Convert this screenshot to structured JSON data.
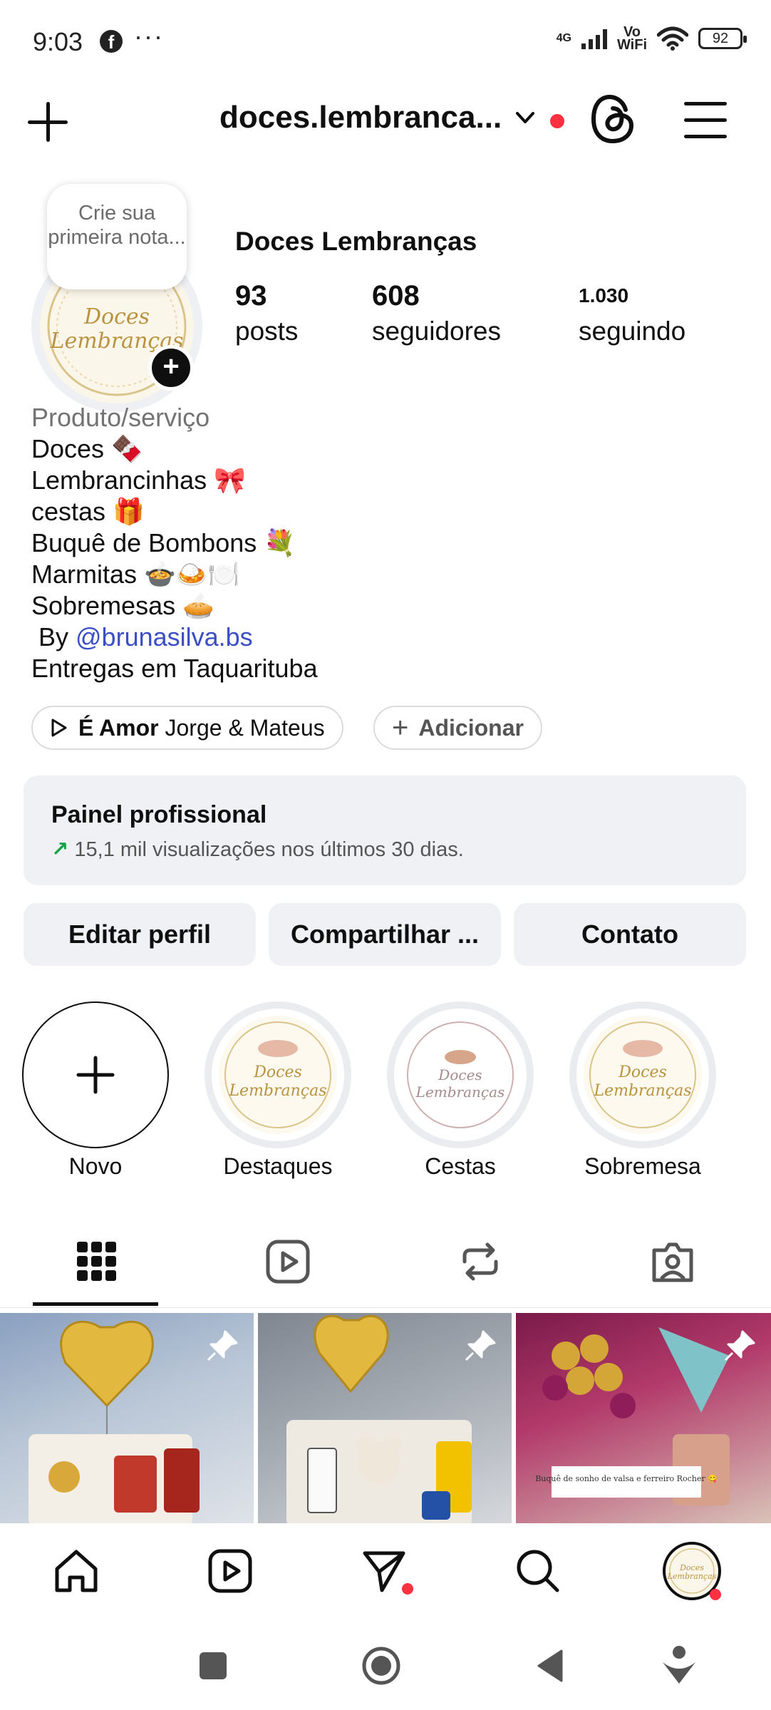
{
  "status_bar": {
    "time": "9:03",
    "facebook_icon": "f",
    "more": "···",
    "network": "4G",
    "wifi_label_top": "Vo",
    "wifi_label_bottom": "WiFi",
    "battery": "92"
  },
  "header": {
    "username": "doces.lembranca...",
    "icons": [
      "plus-icon",
      "chevron-down-icon",
      "threads-icon",
      "menu-icon"
    ],
    "notification_dot_color": "#ff3040"
  },
  "profile": {
    "note_bubble": "Crie sua primeira nota...",
    "avatar_text_top": "Doces",
    "avatar_text_bottom": "Lembranças",
    "display_name": "Doces Lembranças",
    "stats": [
      {
        "value": "93",
        "label": "posts"
      },
      {
        "value": "608",
        "label": "seguidores"
      },
      {
        "value": "1.030",
        "label": "seguindo"
      }
    ]
  },
  "bio": {
    "category": "Produto/serviço",
    "lines": [
      "Doces 🍫",
      "Lembrancinhas 🎀",
      "cestas 🎁",
      "Buquê de Bombons 💐",
      "Marmitas 🍲🍛🍽️",
      "Sobremesas 🥧"
    ],
    "by_prefix": " By ",
    "mention": "@brunasilva.bs",
    "last_line": "Entregas em Taquarituba"
  },
  "music_chip": {
    "song": "É Amor",
    "artist": "Jorge & Mateus"
  },
  "add_chip": {
    "label": "Adicionar"
  },
  "dashboard": {
    "title": "Painel profissional",
    "subtitle": "15,1 mil visualizações nos últimos 30 dias.",
    "trend_color": "#17a34a"
  },
  "actions": {
    "edit": "Editar perfil",
    "share": "Compartilhar ...",
    "contact": "Contato"
  },
  "highlights": [
    {
      "label": "Novo"
    },
    {
      "label": "Destaques"
    },
    {
      "label": "Cestas"
    },
    {
      "label": "Sobremesa"
    }
  ],
  "tabs": [
    "grid-icon",
    "reels-icon",
    "reposts-icon",
    "tagged-icon"
  ],
  "posts": [
    {
      "caption": ""
    },
    {
      "caption": ""
    },
    {
      "caption": "Buquê de sonho de valsa e ferreiro Rocher 😋"
    }
  ],
  "bottom_nav": [
    "home-icon",
    "reels-icon",
    "messages-icon",
    "search-icon",
    "profile-avatar"
  ],
  "system_nav": [
    "recents-icon",
    "home-circle-icon",
    "back-icon",
    "assistant-icon"
  ]
}
